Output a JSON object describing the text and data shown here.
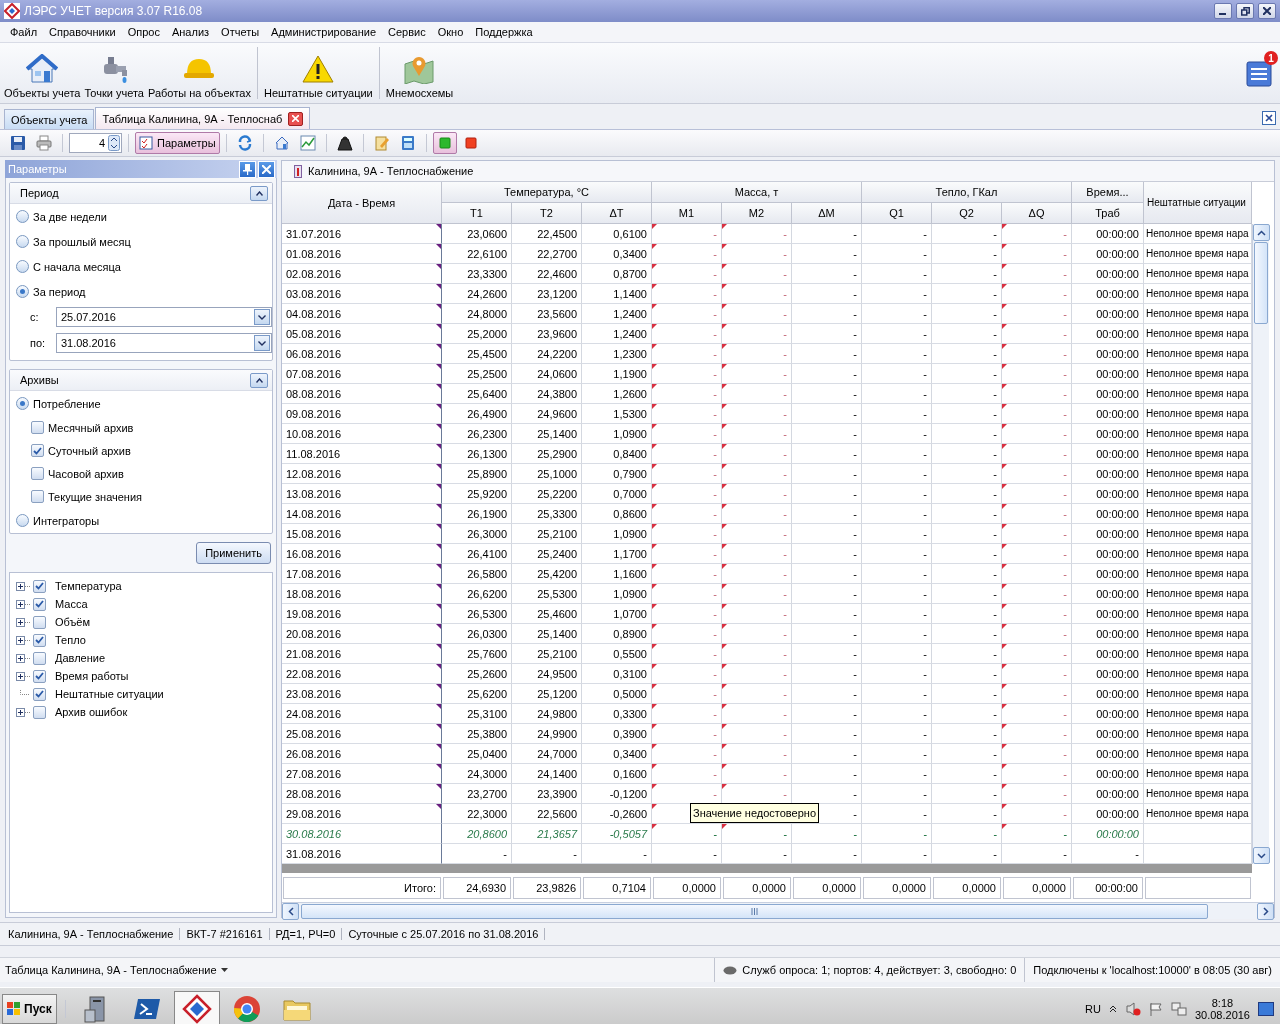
{
  "window": {
    "title": "ЛЭРС УЧЕТ версия 3.07 R16.08"
  },
  "menu": [
    "Файл",
    "Справочники",
    "Опрос",
    "Анализ",
    "Отчеты",
    "Администрирование",
    "Сервис",
    "Окно",
    "Поддержка"
  ],
  "toolbar": [
    [
      {
        "kind": "house",
        "label": "Объекты учета"
      },
      {
        "kind": "faucet",
        "label": "Точки учета"
      },
      {
        "kind": "helmet",
        "label": "Работы на объектах"
      }
    ],
    [
      {
        "kind": "warning",
        "label": "Нештатные ситуации"
      }
    ],
    [
      {
        "kind": "map",
        "label": "Мнемосхемы"
      }
    ]
  ],
  "notifications": {
    "count": "1"
  },
  "doc_tabs": [
    {
      "label": "Объекты учета",
      "selected": false,
      "closable": false
    },
    {
      "label": "Таблица Калинина, 9А - Теплоснаб",
      "selected": true,
      "closable": true
    }
  ],
  "small_toolbar": [
    [
      {
        "kind": "save",
        "pressed": false
      },
      {
        "kind": "print",
        "pressed": false
      }
    ],
    [
      {
        "kind": "spinner",
        "value": "4"
      }
    ],
    [
      {
        "kind": "params",
        "label": "Параметры",
        "pressed": true
      }
    ],
    [
      {
        "kind": "refresh",
        "pressed": false
      }
    ],
    [
      {
        "kind": "house",
        "pressed": false
      },
      {
        "kind": "chart",
        "pressed": false
      }
    ],
    [
      {
        "kind": "weight",
        "pressed": false
      }
    ],
    [
      {
        "kind": "edit",
        "pressed": false
      },
      {
        "kind": "calc",
        "pressed": false
      }
    ],
    [
      {
        "kind": "green",
        "pressed": true
      },
      {
        "kind": "red",
        "pressed": false
      }
    ]
  ],
  "params_panel": {
    "title": "Параметры",
    "period": {
      "title": "Период",
      "options": [
        {
          "label": "За две недели",
          "selected": false
        },
        {
          "label": "За прошлый месяц",
          "selected": false
        },
        {
          "label": "С начала месяца",
          "selected": false
        },
        {
          "label": "За период",
          "selected": true
        }
      ],
      "from_label": "с:",
      "from": "25.07.2016",
      "to_label": "по:",
      "to": "31.08.2016"
    },
    "archives": {
      "title": "Архивы",
      "items": [
        {
          "kind": "radio",
          "label": "Потребление",
          "selected": true
        },
        {
          "kind": "check",
          "label": "Месячный архив",
          "checked": false
        },
        {
          "kind": "check",
          "label": "Суточный архив",
          "checked": true
        },
        {
          "kind": "check",
          "label": "Часовой архив",
          "checked": false
        },
        {
          "kind": "check",
          "label": "Текущие значения",
          "checked": false
        },
        {
          "kind": "radio",
          "label": "Интеграторы",
          "selected": false
        }
      ]
    },
    "apply": "Применить",
    "tree": [
      {
        "kind": "group",
        "label": "Температура",
        "checked": true
      },
      {
        "kind": "group",
        "label": "Масса",
        "checked": true
      },
      {
        "kind": "group",
        "label": "Объём",
        "checked": false
      },
      {
        "kind": "group",
        "label": "Тепло",
        "checked": true
      },
      {
        "kind": "group",
        "label": "Давление",
        "checked": false
      },
      {
        "kind": "group",
        "label": "Время работы",
        "checked": true
      },
      {
        "kind": "leaf",
        "label": "Нештатные ситуации",
        "checked": true
      },
      {
        "kind": "group",
        "label": "Архив ошибок",
        "checked": false
      }
    ]
  },
  "table": {
    "title": "Калинина, 9А - Теплоснабжение",
    "date_header": "Дата - Время",
    "event_header": "Нештатные ситуации",
    "groups": [
      {
        "label": "Температура, °С",
        "columns": [
          {
            "label": "T1",
            "flagged": false
          },
          {
            "label": "T2",
            "flagged": false
          },
          {
            "label": "ΔT",
            "flagged": false
          }
        ]
      },
      {
        "label": "Масса, т",
        "columns": [
          {
            "label": "M1",
            "flagged": true
          },
          {
            "label": "M2",
            "flagged": true
          },
          {
            "label": "ΔM",
            "flagged": false
          }
        ]
      },
      {
        "label": "Тепло, ГКал",
        "columns": [
          {
            "label": "Q1",
            "flagged": false
          },
          {
            "label": "Q2",
            "flagged": false
          },
          {
            "label": "ΔQ",
            "flagged": true
          }
        ]
      },
      {
        "label": "Время...",
        "columns": [
          {
            "label": "Траб",
            "flagged": false
          }
        ]
      }
    ],
    "rows": [
      {
        "date": "31.07.2016",
        "kind": "normal",
        "flagged": true,
        "cells": [
          "23,0600",
          "22,4500",
          "0,6100",
          "-",
          "-",
          "-",
          "-",
          "-",
          "-",
          "00:00:00"
        ],
        "event": "Неполное время нара"
      },
      {
        "date": "01.08.2016",
        "kind": "normal",
        "flagged": true,
        "cells": [
          "22,6100",
          "22,2700",
          "0,3400",
          "-",
          "-",
          "-",
          "-",
          "-",
          "-",
          "00:00:00"
        ],
        "event": "Неполное время нара"
      },
      {
        "date": "02.08.2016",
        "kind": "normal",
        "flagged": true,
        "cells": [
          "23,3300",
          "22,4600",
          "0,8700",
          "-",
          "-",
          "-",
          "-",
          "-",
          "-",
          "00:00:00"
        ],
        "event": "Неполное время нара"
      },
      {
        "date": "03.08.2016",
        "kind": "normal",
        "flagged": true,
        "cells": [
          "24,2600",
          "23,1200",
          "1,1400",
          "-",
          "-",
          "-",
          "-",
          "-",
          "-",
          "00:00:00"
        ],
        "event": "Неполное время нара"
      },
      {
        "date": "04.08.2016",
        "kind": "normal",
        "flagged": true,
        "cells": [
          "24,8000",
          "23,5600",
          "1,2400",
          "-",
          "-",
          "-",
          "-",
          "-",
          "-",
          "00:00:00"
        ],
        "event": "Неполное время нара"
      },
      {
        "date": "05.08.2016",
        "kind": "normal",
        "flagged": true,
        "cells": [
          "25,2000",
          "23,9600",
          "1,2400",
          "-",
          "-",
          "-",
          "-",
          "-",
          "-",
          "00:00:00"
        ],
        "event": "Неполное время нара"
      },
      {
        "date": "06.08.2016",
        "kind": "normal",
        "flagged": true,
        "cells": [
          "25,4500",
          "24,2200",
          "1,2300",
          "-",
          "-",
          "-",
          "-",
          "-",
          "-",
          "00:00:00"
        ],
        "event": "Неполное время нара"
      },
      {
        "date": "07.08.2016",
        "kind": "normal",
        "flagged": true,
        "cells": [
          "25,2500",
          "24,0600",
          "1,1900",
          "-",
          "-",
          "-",
          "-",
          "-",
          "-",
          "00:00:00"
        ],
        "event": "Неполное время нара"
      },
      {
        "date": "08.08.2016",
        "kind": "normal",
        "flagged": true,
        "cells": [
          "25,6400",
          "24,3800",
          "1,2600",
          "-",
          "-",
          "-",
          "-",
          "-",
          "-",
          "00:00:00"
        ],
        "event": "Неполное время нара"
      },
      {
        "date": "09.08.2016",
        "kind": "normal",
        "flagged": true,
        "cells": [
          "26,4900",
          "24,9600",
          "1,5300",
          "-",
          "-",
          "-",
          "-",
          "-",
          "-",
          "00:00:00"
        ],
        "event": "Неполное время нара"
      },
      {
        "date": "10.08.2016",
        "kind": "normal",
        "flagged": true,
        "cells": [
          "26,2300",
          "25,1400",
          "1,0900",
          "-",
          "-",
          "-",
          "-",
          "-",
          "-",
          "00:00:00"
        ],
        "event": "Неполное время нара"
      },
      {
        "date": "11.08.2016",
        "kind": "normal",
        "flagged": true,
        "cells": [
          "26,1300",
          "25,2900",
          "0,8400",
          "-",
          "-",
          "-",
          "-",
          "-",
          "-",
          "00:00:00"
        ],
        "event": "Неполное время нара"
      },
      {
        "date": "12.08.2016",
        "kind": "normal",
        "flagged": true,
        "cells": [
          "25,8900",
          "25,1000",
          "0,7900",
          "-",
          "-",
          "-",
          "-",
          "-",
          "-",
          "00:00:00"
        ],
        "event": "Неполное время нара"
      },
      {
        "date": "13.08.2016",
        "kind": "normal",
        "flagged": true,
        "cells": [
          "25,9200",
          "25,2200",
          "0,7000",
          "-",
          "-",
          "-",
          "-",
          "-",
          "-",
          "00:00:00"
        ],
        "event": "Неполное время нара"
      },
      {
        "date": "14.08.2016",
        "kind": "normal",
        "flagged": true,
        "cells": [
          "26,1900",
          "25,3300",
          "0,8600",
          "-",
          "-",
          "-",
          "-",
          "-",
          "-",
          "00:00:00"
        ],
        "event": "Неполное время нара"
      },
      {
        "date": "15.08.2016",
        "kind": "normal",
        "flagged": true,
        "cells": [
          "26,3000",
          "25,2100",
          "1,0900",
          "-",
          "-",
          "-",
          "-",
          "-",
          "-",
          "00:00:00"
        ],
        "event": "Неполное время нара"
      },
      {
        "date": "16.08.2016",
        "kind": "normal",
        "flagged": true,
        "cells": [
          "26,4100",
          "25,2400",
          "1,1700",
          "-",
          "-",
          "-",
          "-",
          "-",
          "-",
          "00:00:00"
        ],
        "event": "Неполное время нара"
      },
      {
        "date": "17.08.2016",
        "kind": "normal",
        "flagged": true,
        "cells": [
          "26,5800",
          "25,4200",
          "1,1600",
          "-",
          "-",
          "-",
          "-",
          "-",
          "-",
          "00:00:00"
        ],
        "event": "Неполное время нара"
      },
      {
        "date": "18.08.2016",
        "kind": "normal",
        "flagged": true,
        "cells": [
          "26,6200",
          "25,5300",
          "1,0900",
          "-",
          "-",
          "-",
          "-",
          "-",
          "-",
          "00:00:00"
        ],
        "event": "Неполное время нара"
      },
      {
        "date": "19.08.2016",
        "kind": "normal",
        "flagged": true,
        "cells": [
          "26,5300",
          "25,4600",
          "1,0700",
          "-",
          "-",
          "-",
          "-",
          "-",
          "-",
          "00:00:00"
        ],
        "event": "Неполное время нара"
      },
      {
        "date": "20.08.2016",
        "kind": "normal",
        "flagged": true,
        "cells": [
          "26,0300",
          "25,1400",
          "0,8900",
          "-",
          "-",
          "-",
          "-",
          "-",
          "-",
          "00:00:00"
        ],
        "event": "Неполное время нара"
      },
      {
        "date": "21.08.2016",
        "kind": "normal",
        "flagged": true,
        "cells": [
          "25,7600",
          "25,2100",
          "0,5500",
          "-",
          "-",
          "-",
          "-",
          "-",
          "-",
          "00:00:00"
        ],
        "event": "Неполное время нара"
      },
      {
        "date": "22.08.2016",
        "kind": "normal",
        "flagged": true,
        "cells": [
          "25,2600",
          "24,9500",
          "0,3100",
          "-",
          "-",
          "-",
          "-",
          "-",
          "-",
          "00:00:00"
        ],
        "event": "Неполное время нара"
      },
      {
        "date": "23.08.2016",
        "kind": "normal",
        "flagged": true,
        "cells": [
          "25,6200",
          "25,1200",
          "0,5000",
          "-",
          "-",
          "-",
          "-",
          "-",
          "-",
          "00:00:00"
        ],
        "event": "Неполное время нара"
      },
      {
        "date": "24.08.2016",
        "kind": "normal",
        "flagged": true,
        "cells": [
          "25,3100",
          "24,9800",
          "0,3300",
          "-",
          "-",
          "-",
          "-",
          "-",
          "-",
          "00:00:00"
        ],
        "event": "Неполное время нара"
      },
      {
        "date": "25.08.2016",
        "kind": "normal",
        "flagged": true,
        "cells": [
          "25,3800",
          "24,9900",
          "0,3900",
          "-",
          "-",
          "-",
          "-",
          "-",
          "-",
          "00:00:00"
        ],
        "event": "Неполное время нара"
      },
      {
        "date": "26.08.2016",
        "kind": "normal",
        "flagged": true,
        "cells": [
          "25,0400",
          "24,7000",
          "0,3400",
          "-",
          "-",
          "-",
          "-",
          "-",
          "-",
          "00:00:00"
        ],
        "event": "Неполное время нара"
      },
      {
        "date": "27.08.2016",
        "kind": "normal",
        "flagged": true,
        "cells": [
          "24,3000",
          "24,1400",
          "0,1600",
          "-",
          "-",
          "-",
          "-",
          "-",
          "-",
          "00:00:00"
        ],
        "event": "Неполное время нара"
      },
      {
        "date": "28.08.2016",
        "kind": "normal",
        "flagged": true,
        "cells": [
          "23,2700",
          "23,3900",
          "-0,1200",
          "-",
          "-",
          "-",
          "-",
          "-",
          "-",
          "00:00:00"
        ],
        "event": "Неполное время нара"
      },
      {
        "date": "29.08.2016",
        "kind": "normal",
        "flagged": true,
        "cells": [
          "22,3000",
          "22,5600",
          "-0,2600",
          null,
          null,
          "-",
          "-",
          "-",
          "-",
          "00:00:00"
        ],
        "event": "Неполное время нара",
        "tooltip": "Значение недостоверно"
      },
      {
        "date": "30.08.2016",
        "kind": "current",
        "flagged": true,
        "cells": [
          "20,8600",
          "21,3657",
          "-0,5057",
          "-",
          "-",
          "-",
          "-",
          "-",
          "-",
          "00:00:00"
        ]
      },
      {
        "date": "31.08.2016",
        "kind": "normal",
        "flagged": false,
        "cells": [
          "-",
          "-",
          "-",
          "-",
          "-",
          "-",
          "-",
          "-",
          "-",
          "-"
        ]
      }
    ],
    "totals_label": "Итого:",
    "totals": [
      "24,6930",
      "23,9826",
      "0,7104",
      "0,0000",
      "0,0000",
      "0,0000",
      "0,0000",
      "0,0000",
      "0,0000",
      "00:00:00"
    ]
  },
  "status_line": [
    "Калинина, 9А - Теплоснабжение",
    "ВКТ-7 #216161",
    "РД=1, РЧ=0",
    "Суточные с 25.07.2016 по 31.08.2016"
  ],
  "bottom_bar": {
    "window": "Таблица Калинина, 9А - Теплоснабжение",
    "services": "Служб опроса: 1; портов: 4, действует: 3, свободно: 0",
    "connection": "Подключены к 'localhost:10000' в 08:05 (30 авг)"
  },
  "taskbar": {
    "start": "Пуск",
    "apps": [
      {
        "kind": "server",
        "selected": false
      },
      {
        "kind": "shell",
        "selected": false
      },
      {
        "kind": "lers",
        "selected": true
      },
      {
        "kind": "browser",
        "selected": false
      },
      {
        "kind": "folder",
        "selected": false
      }
    ],
    "lang": "RU",
    "time": "8:18",
    "date": "30.08.2016"
  }
}
